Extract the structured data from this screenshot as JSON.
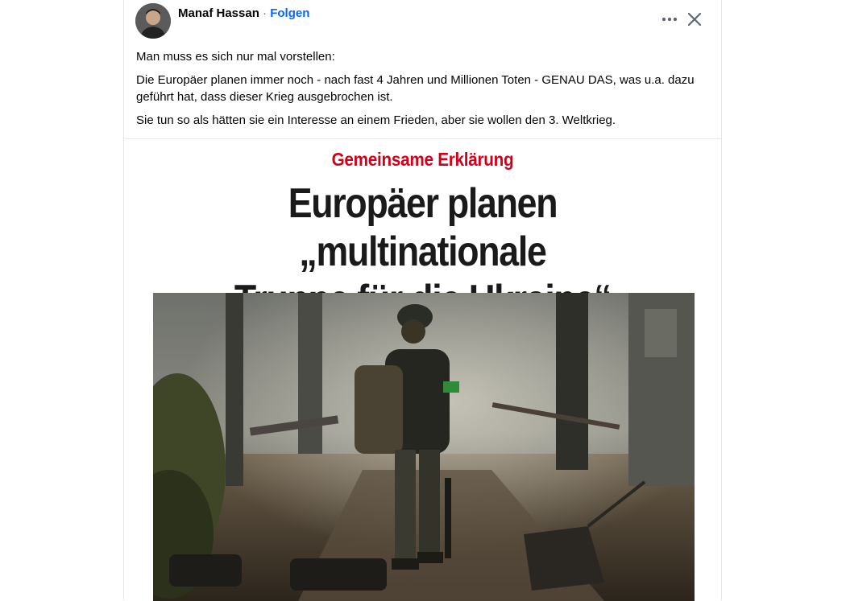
{
  "post": {
    "author": "Manaf Hassan",
    "separator": "·",
    "follow_label": "Folgen",
    "paragraphs": [
      "Man muss es sich nur mal vorstellen:",
      "Die Europäer planen immer noch - nach fast 4 Jahren und Millionen Toten  - GENAU DAS, was u.a. dazu geführt hat, dass dieser Krieg ausgebrochen ist.",
      "Sie tun so als hätten sie ein Interesse an einem Frieden, aber sie wollen den 3. Weltkrieg."
    ]
  },
  "media": {
    "kicker": "Gemeinsame Erklärung",
    "headline_line1": "Europäer planen „multinationale",
    "headline_line2": "Truppe für die Ukraine“"
  },
  "icons": {
    "more": "more-options-icon",
    "close": "close-icon"
  },
  "colors": {
    "follow": "#0866ff",
    "kicker": "#d0021b",
    "headline": "#1a1a1a"
  }
}
